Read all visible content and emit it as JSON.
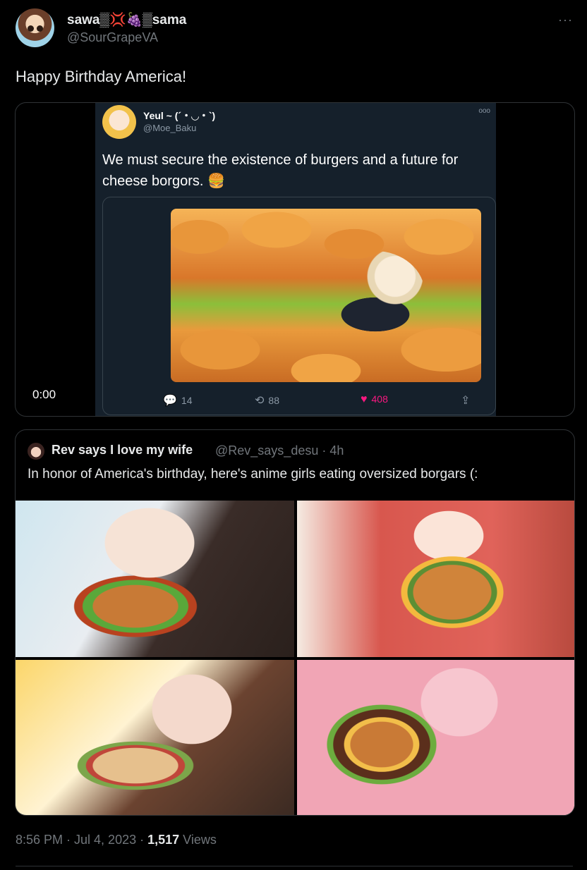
{
  "tweet": {
    "author_name": "sawa▒💢🍇▒sama",
    "author_handle": "@SourGrapeVA",
    "text": "Happy Birthday America!",
    "more_icon": "···",
    "timestamp": "8:56 PM · Jul 4, 2023 · ",
    "views_count": "1,517",
    "views_label": " Views"
  },
  "video": {
    "timecode": "0:00",
    "inner_tweet": {
      "author_name": "Yeul ~ (´・◡・`)",
      "author_handle": "@Moe_Baku",
      "more_icon": "ooo",
      "text": "We must secure the existence of burgers and a future for cheese borgors. 🍔",
      "replies": "14",
      "retweets": "88",
      "likes": "408"
    }
  },
  "quote": {
    "author_name": "Rev says I love my wife",
    "author_handle": "@Rev_says_desu · 4h",
    "text": "In honor of America's birthday, here's anime girls eating oversized borgars (:"
  },
  "colors": {
    "background": "#000000",
    "primary_text": "#e7e9ea",
    "secondary_text": "#71767b",
    "border": "#2f3336",
    "like": "#f91880"
  },
  "icons": [
    "reply-icon",
    "retweet-icon",
    "heart-icon",
    "share-icon",
    "more-icon"
  ]
}
